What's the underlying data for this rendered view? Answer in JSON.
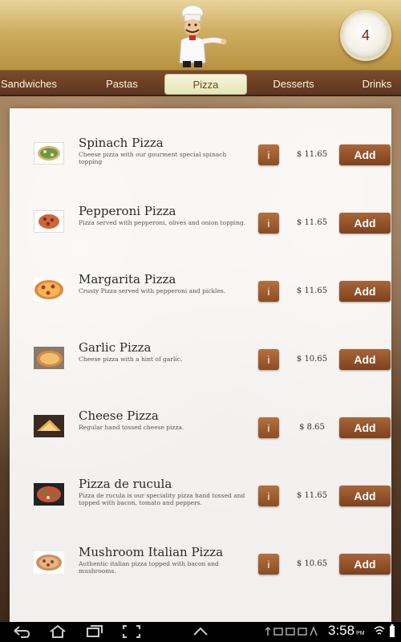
{
  "header": {
    "cart_count": "4"
  },
  "tabs": [
    {
      "label": "Sandwiches"
    },
    {
      "label": "Pastas"
    },
    {
      "label": "Pizza"
    },
    {
      "label": "Desserts"
    },
    {
      "label": "Drinks"
    }
  ],
  "active_tab": "Pizza",
  "items": [
    {
      "name": "Spinach Pizza",
      "description": "Cheese pizza with our gourment special spinach topping",
      "price": "$ 11.65",
      "info_label": "i",
      "add_label": "Add"
    },
    {
      "name": "Pepperoni Pizza",
      "description": "Pizza served with pepperoni, olives and onion topping.",
      "price": "$ 11.65",
      "info_label": "i",
      "add_label": "Add"
    },
    {
      "name": "Margarita Pizza",
      "description": "Crusty Pizza served with pepperoni and pickles.",
      "price": "$ 11.65",
      "info_label": "i",
      "add_label": "Add"
    },
    {
      "name": "Garlic Pizza",
      "description": "Cheese pizza with a hint of garlic.",
      "price": "$ 10.65",
      "info_label": "i",
      "add_label": "Add"
    },
    {
      "name": "Cheese Pizza",
      "description": "Regular hand tossed cheese pizza.",
      "price": "$ 8.65",
      "info_label": "i",
      "add_label": "Add"
    },
    {
      "name": "Pizza de rucula",
      "description": "Pizza de rucula is our speciality pizza hand tossed and topped with bacon, tomato and peppers.",
      "price": "$ 11.65",
      "info_label": "i",
      "add_label": "Add"
    },
    {
      "name": "Mushroom Italian Pizza",
      "description": "Authentic italian pizza topped with bacon and mushrooms.",
      "price": "$ 10.65",
      "info_label": "i",
      "add_label": "Add"
    }
  ],
  "statusbar": {
    "time": "3:58",
    "time_suffix": "PM"
  },
  "icons": {
    "back": "back-icon",
    "home": "home-icon",
    "recents": "recent-apps-icon",
    "screenshot": "screenshot-icon",
    "up": "chevron-up-icon"
  },
  "colors": {
    "button_brown": "#8b4d24",
    "header_gold": "#cfae62",
    "tab_bar": "#5e3620"
  }
}
